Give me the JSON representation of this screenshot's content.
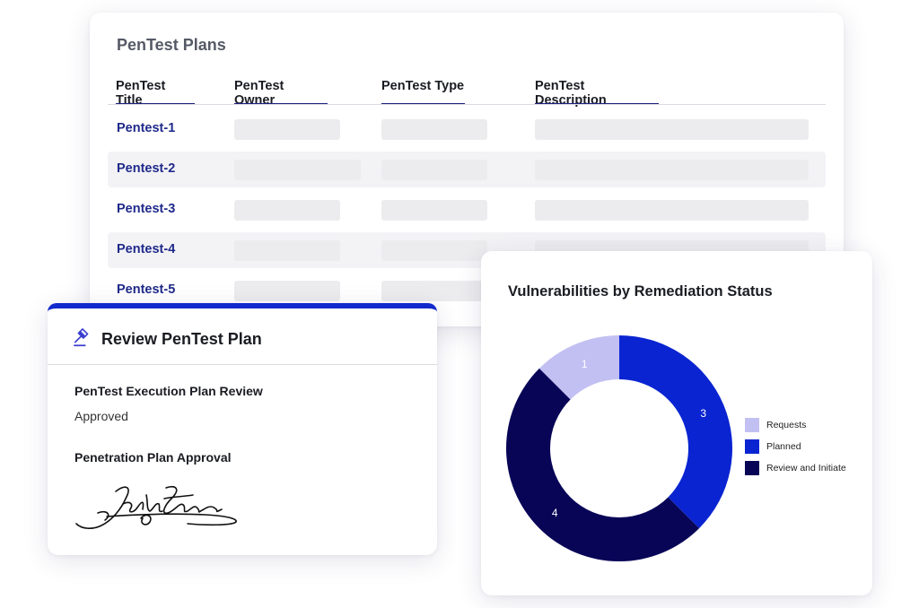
{
  "plans": {
    "title": "PenTest Plans",
    "columns": [
      "PenTest Title",
      "PenTest Owner",
      "PenTest Type",
      "PenTest Description"
    ],
    "rows": [
      "Pentest-1",
      "Pentest-2",
      "Pentest-3",
      "Pentest-4",
      "Pentest-5"
    ]
  },
  "review": {
    "title": "Review PenTest Plan",
    "icon": "gavel-icon",
    "execution_label": "PenTest Execution Plan Review",
    "execution_value": "Approved",
    "approval_label": "Penetration Plan Approval"
  },
  "chart_data": {
    "type": "pie",
    "title": "Vulnerabilities by Remediation Status",
    "categories": [
      "Requests",
      "Planned",
      "Review and Initiate"
    ],
    "values": [
      1,
      3,
      4
    ],
    "colors": [
      "#c2c0f2",
      "#0a24d1",
      "#080557"
    ],
    "legend": "right"
  },
  "colors": {
    "accent": "#1229cc",
    "link": "#1f2a8a",
    "dark_navy": "#080557"
  }
}
